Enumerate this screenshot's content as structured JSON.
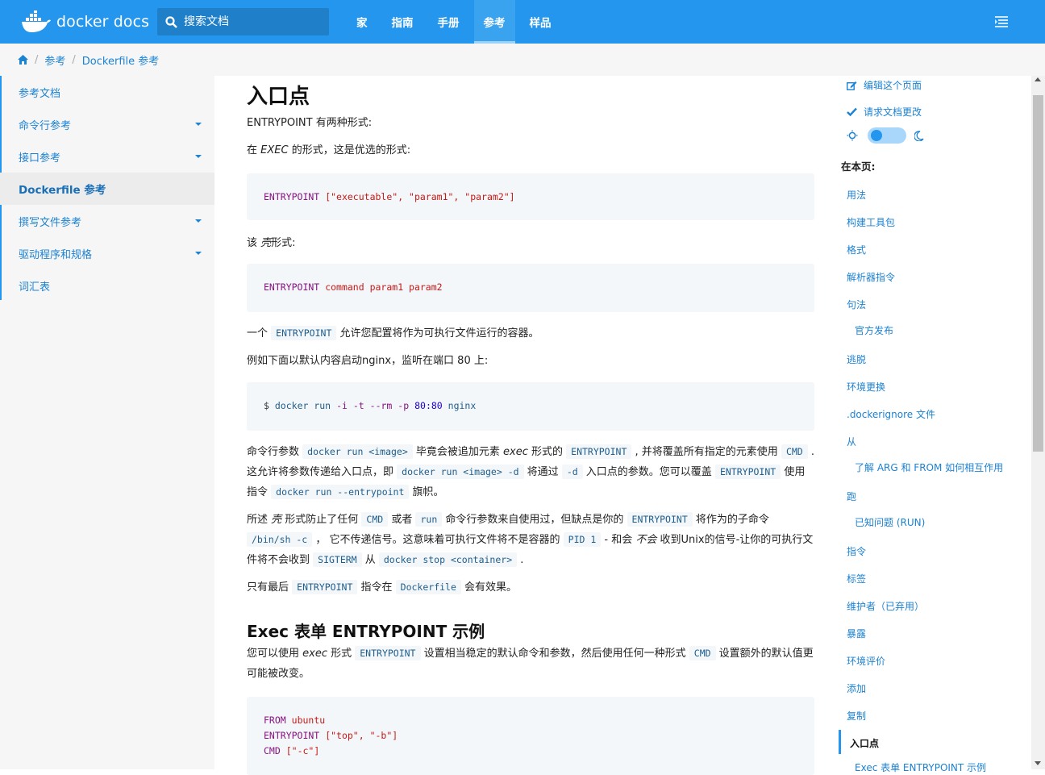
{
  "header": {
    "logo_text": "docker docs",
    "search_placeholder": "搜索文档",
    "nav": [
      {
        "label": "家",
        "active": false
      },
      {
        "label": "指南",
        "active": false
      },
      {
        "label": "手册",
        "active": false
      },
      {
        "label": "参考",
        "active": true
      },
      {
        "label": "样品",
        "active": false
      }
    ]
  },
  "breadcrumb": [
    "参考",
    "Dockerfile 参考"
  ],
  "sidebar": {
    "items": [
      {
        "label": "参考文档",
        "caret": false,
        "active": false
      },
      {
        "label": "命令行参考",
        "caret": true,
        "active": false
      },
      {
        "label": "接口参考",
        "caret": true,
        "active": false
      },
      {
        "label": "Dockerfile 参考",
        "caret": false,
        "active": true
      },
      {
        "label": "撰写文件参考",
        "caret": true,
        "active": false
      },
      {
        "label": "驱动程序和规格",
        "caret": true,
        "active": false
      },
      {
        "label": "词汇表",
        "caret": false,
        "active": false
      }
    ]
  },
  "content": {
    "h1": "入口点",
    "p_intro": "ENTRYPOINT 有两种形式:",
    "p_exec_pre": "在 ",
    "p_exec_em": "EXEC",
    "p_exec_post": " 的形式，这是优选的形式:",
    "code1_kw": "ENTRYPOINT",
    "code1_rest": "[\"executable\", \"param1\", \"param2\"]",
    "p_shell_pre": "该 ",
    "p_shell_em": "壳",
    "p_shell_post": "形式:",
    "code2_kw": "ENTRYPOINT",
    "code2_rest": "command param1 param2",
    "p_allow_pre": "一个 ",
    "p_allow_code": "ENTRYPOINT",
    "p_allow_post": " 允许您配置将作为可执行文件运行的容器。",
    "p_example": "例如下面以默认内容启动nginx，监听在端口 80 上:",
    "code3_prompt": "$",
    "code3_cmd": "docker run",
    "code3_i": "-i",
    "code3_t": "-t",
    "code3_rm": "--rm",
    "code3_p": "-p",
    "code3_port": "80:80",
    "code3_img": "nginx",
    "p_args_1": "命令行参数 ",
    "p_args_code1": "docker run <image>",
    "p_args_2": " 毕竟会被追加元素 ",
    "p_args_em1": "exec",
    "p_args_3": " 形式的 ",
    "p_args_code2": "ENTRYPOINT",
    "p_args_4": " , 并将覆盖所有指定的元素使用",
    "p_args_code3": "CMD",
    "p_args_5": " . 这允许将参数传递给入口点，即 ",
    "p_args_code4": "docker run <image> -d",
    "p_args_6": " 将通过 ",
    "p_args_code5": "-d",
    "p_args_7": " 入口点的参数。您可以覆盖",
    "p_args_code6": "ENTRYPOINT",
    "p_args_8": " 使用指令 ",
    "p_args_code7": "docker run --entrypoint",
    "p_args_9": " 旗帜。",
    "p_shell2_1": "所述 ",
    "p_shell2_em": "壳",
    "p_shell2_2": " 形式防止了任何 ",
    "p_shell2_code1": "CMD",
    "p_shell2_3": " 或者 ",
    "p_shell2_code2": "run",
    "p_shell2_4": " 命令行参数来自使用过，但缺点是你的 ",
    "p_shell2_code3": "ENTRYPOINT",
    "p_shell2_5": " 将作为的子命令",
    "p_shell2_code4": "/bin/sh -c",
    "p_shell2_6": " ， 它不传递信号。这意味着可执行文件将不是容器的 ",
    "p_shell2_code5": "PID 1",
    "p_shell2_7": " - 和会 ",
    "p_shell2_em2": "不会",
    "p_shell2_8": " 收到Unix的信号-让你的可执行文件将不会收到 ",
    "p_shell2_code6": "SIGTERM",
    "p_shell2_9": " 从 ",
    "p_shell2_code7": "docker stop <container>",
    "p_shell2_10": " .",
    "p_last_1": "只有最后 ",
    "p_last_code1": "ENTRYPOINT",
    "p_last_2": " 指令在 ",
    "p_last_code2": "Dockerfile",
    "p_last_3": " 会有效果。",
    "h2": "Exec 表单 ENTRYPOINT 示例",
    "p_h2_1": "您可以使用 ",
    "p_h2_em": "exec",
    "p_h2_2": " 形式 ",
    "p_h2_code1": "ENTRYPOINT",
    "p_h2_3": " 设置相当稳定的默认命令和参数，然后使用任何一种形式 ",
    "p_h2_code2": "CMD",
    "p_h2_4": " 设置额外的默认值更可能被改变。",
    "code4_l1_kw": "FROM",
    "code4_l1_val": "ubuntu",
    "code4_l2_kw": "ENTRYPOINT",
    "code4_l2_val": "[\"top\", \"-b\"]",
    "code4_l3_kw": "CMD",
    "code4_l3_val": "[\"-c\"]"
  },
  "rail": {
    "edit_label": "编辑这个页面",
    "request_label": "请求文档更改",
    "toc_title": "在本页:",
    "toc": [
      {
        "label": "用法",
        "sub": false
      },
      {
        "label": "构建工具包",
        "sub": false
      },
      {
        "label": "格式",
        "sub": false
      },
      {
        "label": "解析器指令",
        "sub": false
      },
      {
        "label": "句法",
        "sub": false
      },
      {
        "label": "官方发布",
        "sub": true
      },
      {
        "label": "逃脱",
        "sub": false
      },
      {
        "label": "环境更换",
        "sub": false
      },
      {
        "label": ".dockerignore 文件",
        "sub": false
      },
      {
        "label": "从",
        "sub": false
      },
      {
        "label": "了解 ARG 和 FROM 如何相互作用",
        "sub": true
      },
      {
        "label": "跑",
        "sub": false
      },
      {
        "label": "已知问题 (RUN)",
        "sub": true
      },
      {
        "label": "指令",
        "sub": false
      },
      {
        "label": "标签",
        "sub": false
      },
      {
        "label": "维护者（已弃用）",
        "sub": false
      },
      {
        "label": "暴露",
        "sub": false
      },
      {
        "label": "环境评价",
        "sub": false
      },
      {
        "label": "添加",
        "sub": false
      },
      {
        "label": "复制",
        "sub": false
      },
      {
        "label": "入口点",
        "sub": false,
        "active": true
      },
      {
        "label": "Exec 表单 ENTRYPOINT 示例",
        "sub": true
      }
    ]
  },
  "colors": {
    "brand": "#2496ed",
    "link": "#1c82d2",
    "keyword": "#881280",
    "string": "#c41a16"
  }
}
